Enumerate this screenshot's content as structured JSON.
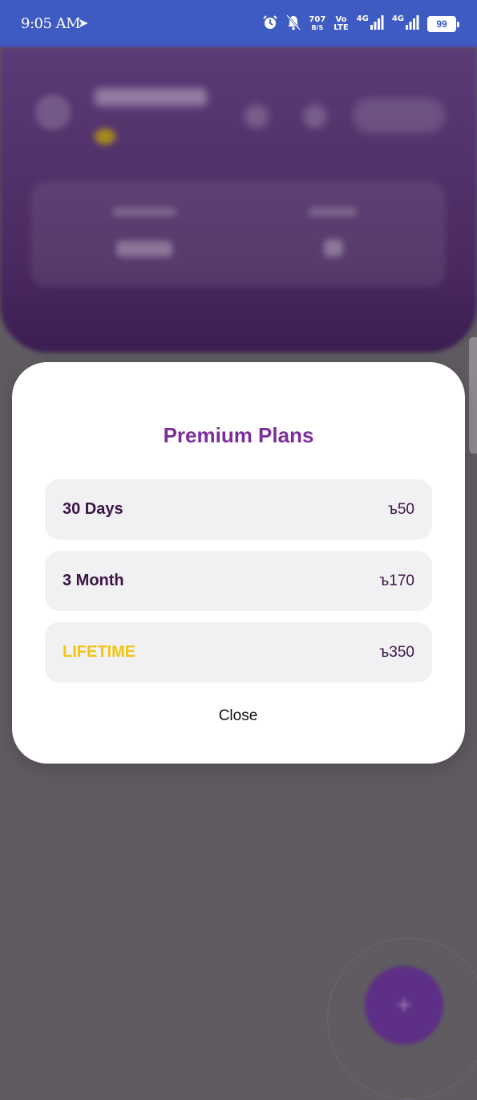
{
  "status_bar": {
    "time": "9:05 AM",
    "arrow_icon": "navigation-arrow-icon",
    "net_speed_value": "707",
    "net_speed_unit": "B/S",
    "volte_top": "Vo",
    "volte_bottom": "LTE",
    "sim1_label": "4G",
    "sim2_label": "4G",
    "battery": "99"
  },
  "modal": {
    "title": "Premium Plans",
    "plans": [
      {
        "name": "30 Days",
        "price": "ъ50"
      },
      {
        "name": "3 Month",
        "price": "ъ170"
      },
      {
        "name": "LIFETIME",
        "price": "ъ350"
      }
    ],
    "close_label": "Close"
  },
  "colors": {
    "status_bar": "#3e5ac3",
    "title": "#7b2f9b",
    "plan_text": "#3a1446",
    "lifetime": "#f2c412",
    "plan_bg": "#f1f0f2",
    "scrim": "#5f5b61"
  }
}
